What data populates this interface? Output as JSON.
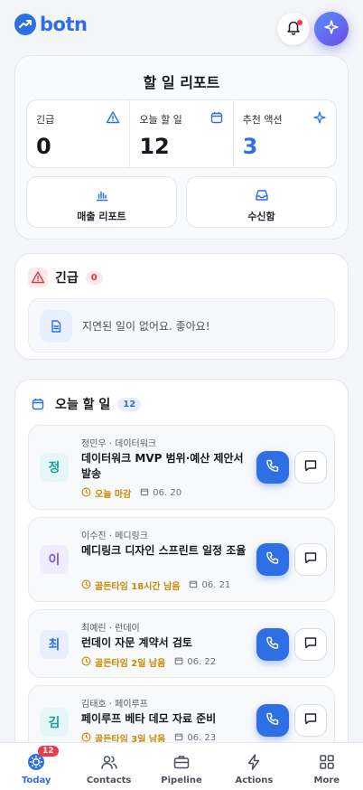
{
  "header": {
    "logo_text": "botn",
    "bell_icon": "bell-icon",
    "ai_icon": "sparkle-icon",
    "accent": "#2f6fe4"
  },
  "report": {
    "title": "할 일 리포트",
    "stats": [
      {
        "label": "긴급",
        "value": "0",
        "icon": "warning-icon"
      },
      {
        "label": "오늘 할 일",
        "value": "12",
        "icon": "calendar-icon"
      },
      {
        "label": "추천 액션",
        "value": "3",
        "icon": "sparkle-icon"
      }
    ],
    "buttons": [
      {
        "label": "매출 리포트",
        "icon": "bar-chart-icon"
      },
      {
        "label": "수신함",
        "icon": "inbox-icon"
      }
    ]
  },
  "urgent": {
    "title": "긴급",
    "count": "0",
    "empty_text": "지연된 일이 없어요. 좋아요!"
  },
  "today": {
    "title": "오늘 할 일",
    "count": "12",
    "tasks": [
      {
        "avatar": "정",
        "meta": "정민우 · 데이터워크",
        "title": "데이터워크 MVP 범위·예산 제안서 발송",
        "due": "오늘 마감",
        "date": "06. 20"
      },
      {
        "avatar": "이",
        "meta": "이수진 · 메디링크",
        "title": "메디링크 디자인 스프린트 일정 조율",
        "due": "골든타임 18시간 남음",
        "date": "06. 21"
      },
      {
        "avatar": "최",
        "meta": "최예린 · 런데이",
        "title": "런데이 자문 계약서 검토",
        "due": "골든타임 2일 남음",
        "date": "06. 22"
      },
      {
        "avatar": "김",
        "meta": "김태호 · 페이루프",
        "title": "페이루프 베타 데모 자료 준비",
        "due": "골든타임 3일 남음",
        "date": "06. 23"
      }
    ]
  },
  "tabbar": {
    "tabs": [
      {
        "label": "Today",
        "badge": "12",
        "icon": "sun-icon",
        "active": true
      },
      {
        "label": "Contacts",
        "icon": "people-icon"
      },
      {
        "label": "Pipeline",
        "icon": "briefcase-icon"
      },
      {
        "label": "Actions",
        "icon": "bolt-icon"
      },
      {
        "label": "More",
        "icon": "grid-icon"
      }
    ]
  }
}
